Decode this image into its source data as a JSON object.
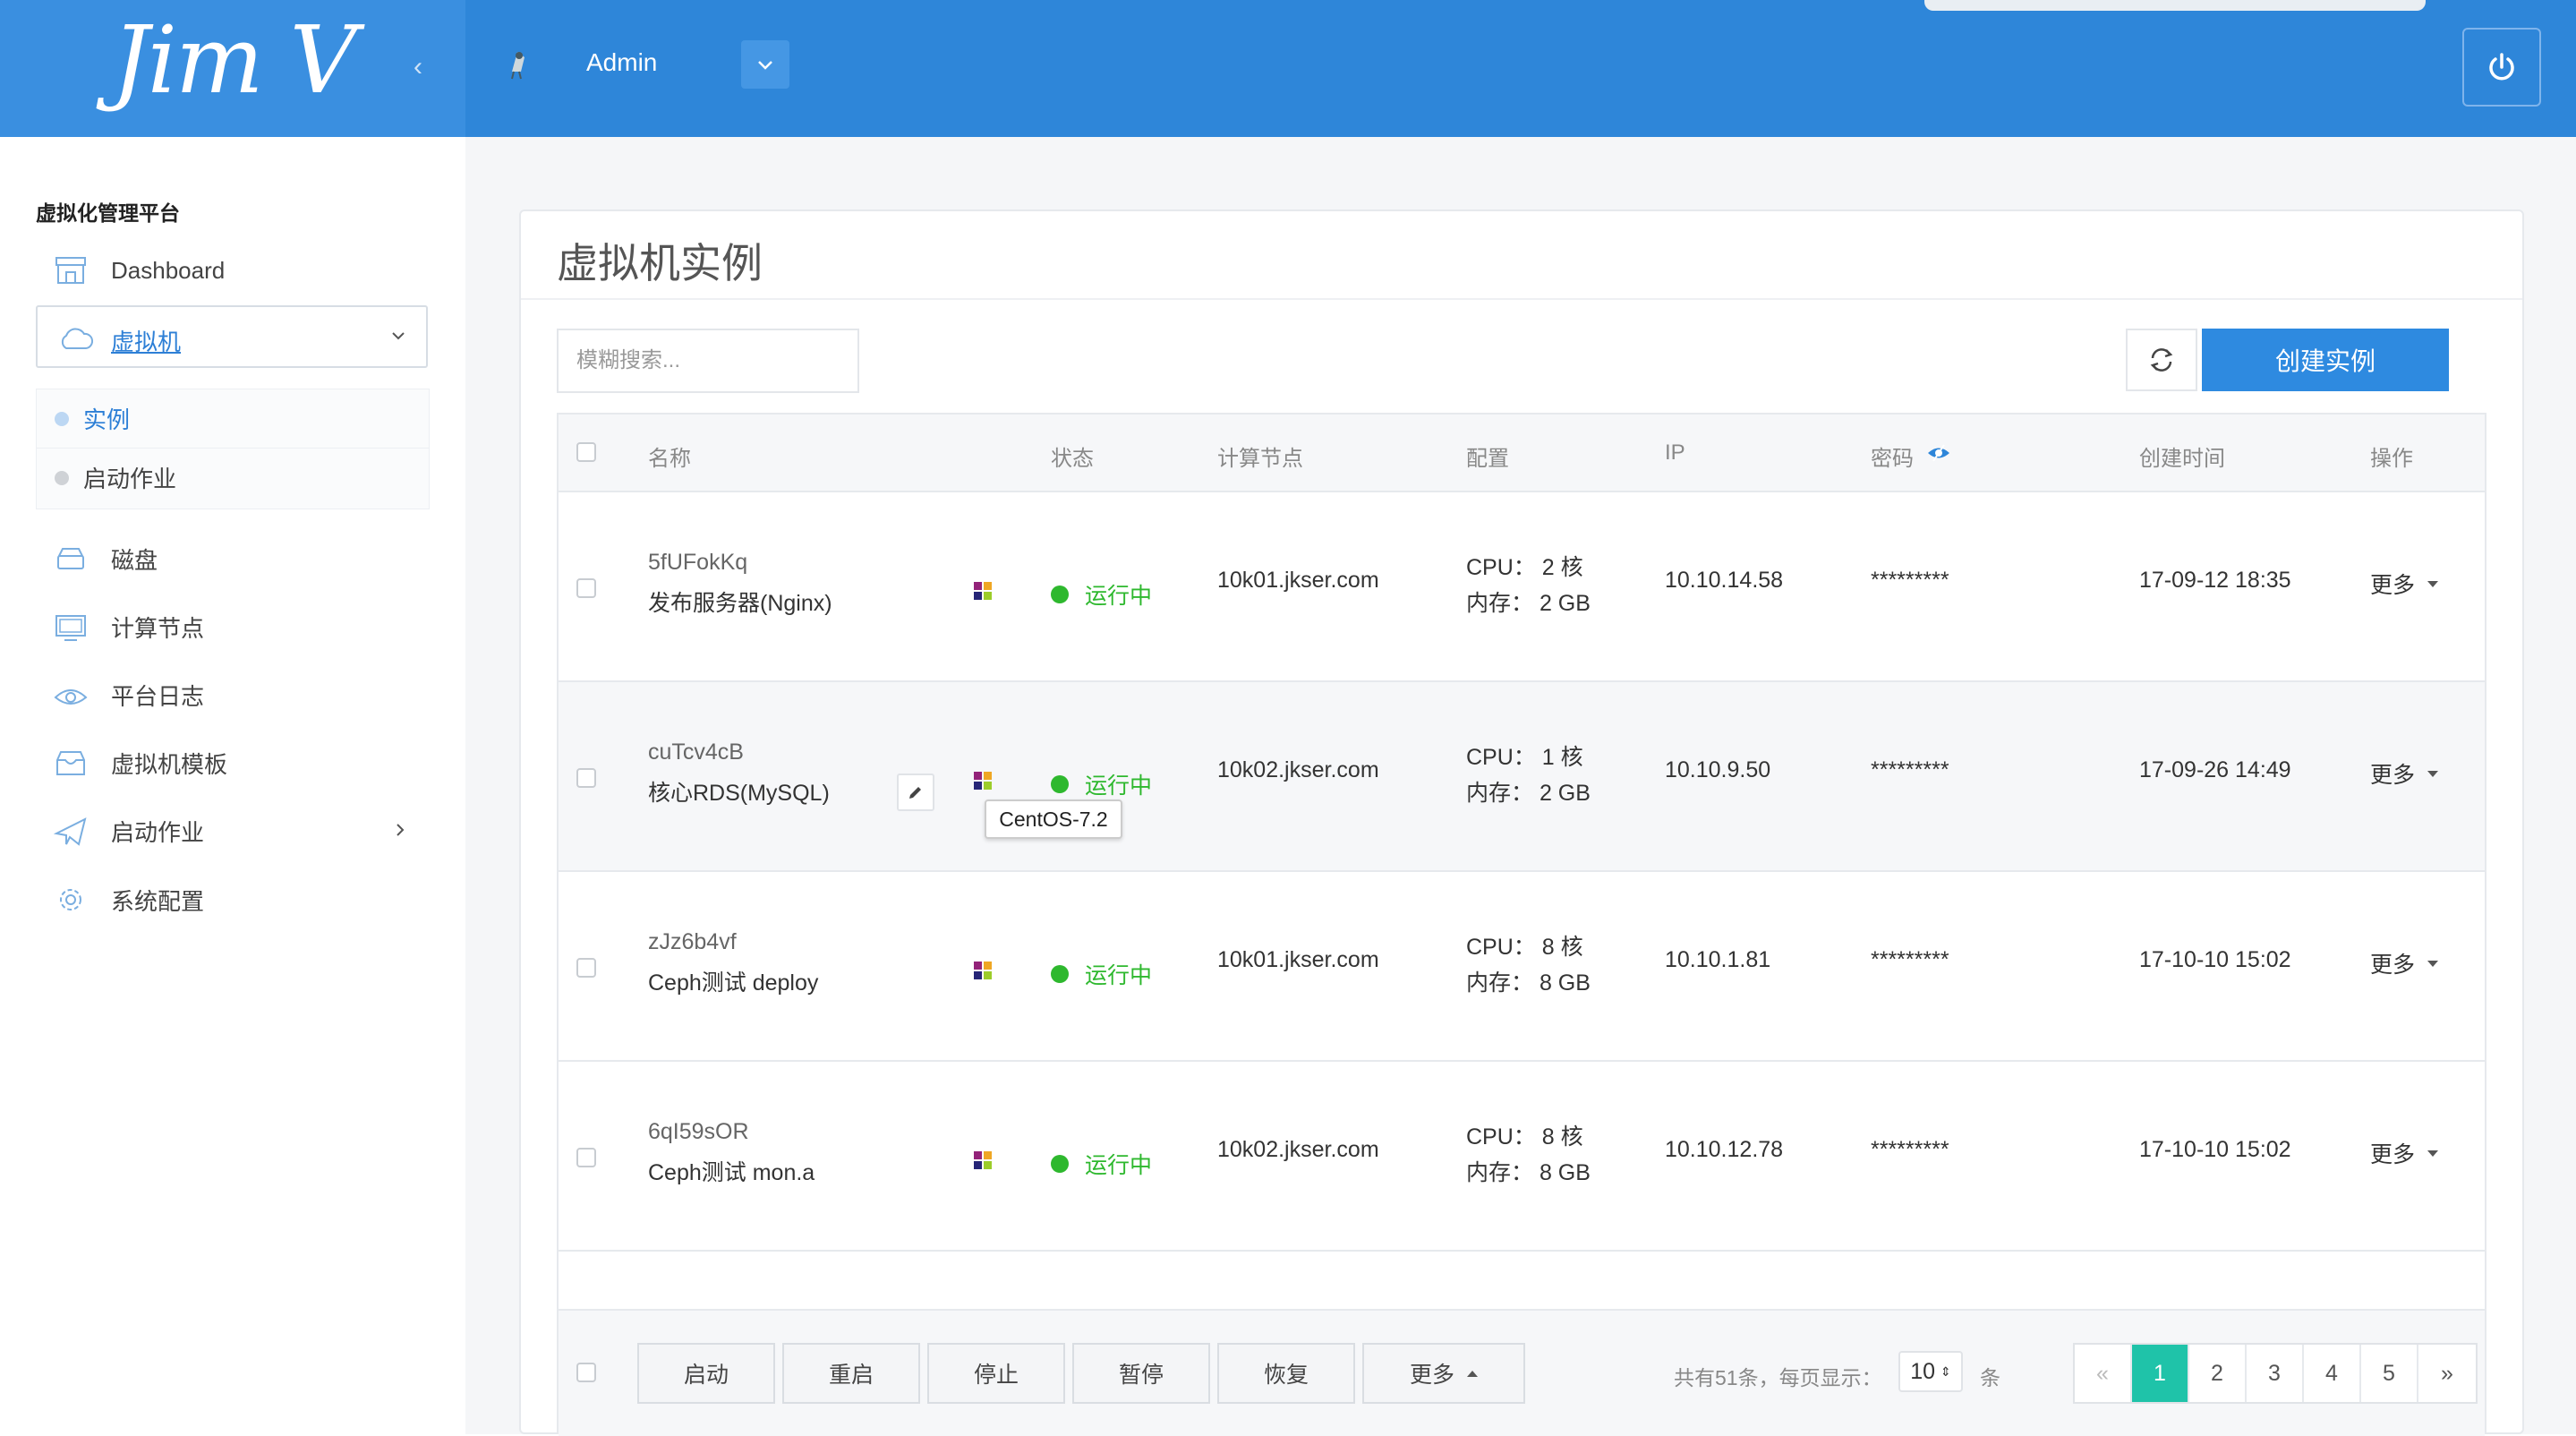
{
  "header": {
    "logo_text": "Jim V",
    "user_name": "Admin"
  },
  "sidebar": {
    "title": "虚拟化管理平台",
    "dashboard_label": "Dashboard",
    "vm_label": "虚拟机",
    "vm_sub": [
      {
        "label": "实例",
        "active": true
      },
      {
        "label": "启动作业",
        "active": false
      }
    ],
    "items": [
      {
        "label": "磁盘",
        "icon": "disk-icon"
      },
      {
        "label": "计算节点",
        "icon": "monitor-icon"
      },
      {
        "label": "平台日志",
        "icon": "eye-icon"
      },
      {
        "label": "虚拟机模板",
        "icon": "template-icon"
      },
      {
        "label": "启动作业",
        "icon": "paper-plane-icon"
      },
      {
        "label": "系统配置",
        "icon": "gear-icon"
      }
    ]
  },
  "main": {
    "title": "虚拟机实例",
    "search_placeholder": "模糊搜索...",
    "create_label": "创建实例",
    "columns": [
      "名称",
      "状态",
      "计算节点",
      "配置",
      "IP",
      "密码",
      "创建时间",
      "操作"
    ],
    "rows": [
      {
        "id": "5fUFokKq",
        "name": "发布服务器(Nginx)",
        "status": "运行中",
        "node": "10k01.jkser.com",
        "cpu": "CPU： 2 核",
        "mem": "内存： 2 GB",
        "ip": "10.10.14.58",
        "password": "*********",
        "created": "17-09-12 18:35",
        "action": "更多"
      },
      {
        "id": "cuTcv4cB",
        "name": "核心RDS(MySQL)",
        "status": "运行中",
        "node": "10k02.jkser.com",
        "cpu": "CPU： 1 核",
        "mem": "内存： 2 GB",
        "ip": "10.10.9.50",
        "password": "*********",
        "created": "17-09-26 14:49",
        "action": "更多"
      },
      {
        "id": "zJz6b4vf",
        "name": "Ceph测试 deploy",
        "status": "运行中",
        "node": "10k01.jkser.com",
        "cpu": "CPU： 8 核",
        "mem": "内存： 8 GB",
        "ip": "10.10.1.81",
        "password": "*********",
        "created": "17-10-10 15:02",
        "action": "更多"
      },
      {
        "id": "6qI59sOR",
        "name": "Ceph测试 mon.a",
        "status": "运行中",
        "node": "10k02.jkser.com",
        "cpu": "CPU： 8 核",
        "mem": "内存： 8 GB",
        "ip": "10.10.12.78",
        "password": "*********",
        "created": "17-10-10 15:02",
        "action": "更多"
      }
    ],
    "tooltip": "CentOS-7.2",
    "footer": {
      "buttons": [
        "启动",
        "重启",
        "停止",
        "暂停",
        "恢复"
      ],
      "more_label": "更多",
      "count_text": "共有51条，每页显示：",
      "page_size": "10",
      "unit": "条",
      "pages": [
        "«",
        "1",
        "2",
        "3",
        "4",
        "5",
        "»"
      ],
      "current_page": "1"
    }
  },
  "colors": {
    "header_bg": "#2e86d9",
    "primary": "#2e8ae0",
    "running": "#2eb82e",
    "pager_active": "#1fc3a9"
  }
}
